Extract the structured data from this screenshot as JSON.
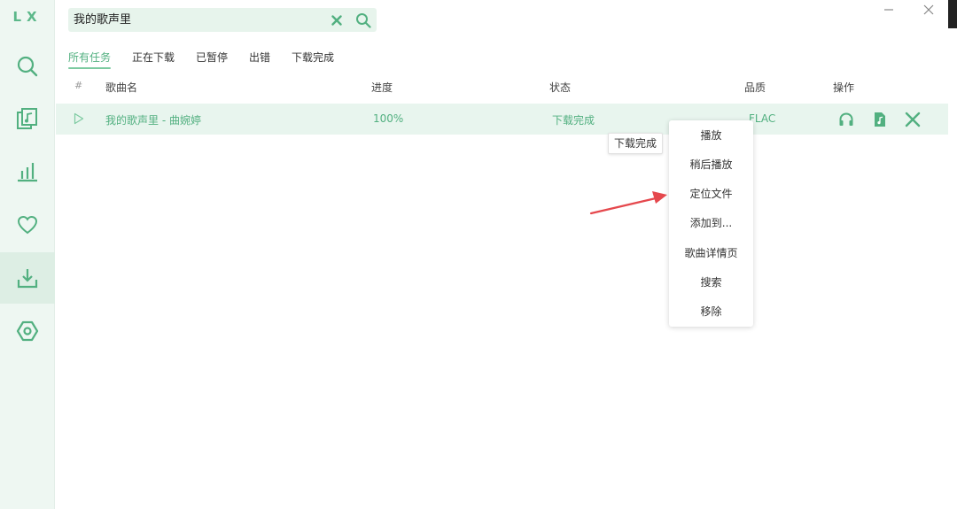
{
  "app": {
    "logo": "LX"
  },
  "colors": {
    "accent": "#52b080",
    "sidebar_bg": "#eef7f2",
    "row_bg": "#e8f5ee",
    "arrow": "#e5484d"
  },
  "sidebar": {
    "items": [
      {
        "name": "search",
        "icon": "search-icon",
        "active": false
      },
      {
        "name": "song-list",
        "icon": "music-file-icon",
        "active": false
      },
      {
        "name": "leaderboard",
        "icon": "bar-chart-icon",
        "active": false
      },
      {
        "name": "favorites",
        "icon": "heart-icon",
        "active": false
      },
      {
        "name": "download",
        "icon": "download-icon",
        "active": true
      },
      {
        "name": "settings",
        "icon": "hexagon-settings-icon",
        "active": false
      }
    ]
  },
  "search": {
    "value": "我的歌声里",
    "placeholder": ""
  },
  "window": {
    "minimize_icon": "minimize-icon",
    "close_icon": "close-icon"
  },
  "tabs": [
    {
      "label": "所有任务",
      "active": true
    },
    {
      "label": "正在下载",
      "active": false
    },
    {
      "label": "已暂停",
      "active": false
    },
    {
      "label": "出错",
      "active": false
    },
    {
      "label": "下载完成",
      "active": false
    }
  ],
  "table": {
    "headers": {
      "index": "#",
      "name": "歌曲名",
      "progress": "进度",
      "status": "状态",
      "quality": "品质",
      "actions": "操作"
    },
    "rows": [
      {
        "name": "我的歌声里 - 曲婉婷",
        "progress": "100%",
        "status": "下载完成",
        "quality": "FLAC"
      }
    ]
  },
  "tooltip": {
    "text": "下载完成"
  },
  "context_menu": {
    "items": [
      "播放",
      "稍后播放",
      "定位文件",
      "添加到...",
      "歌曲详情页",
      "搜索",
      "移除"
    ]
  }
}
